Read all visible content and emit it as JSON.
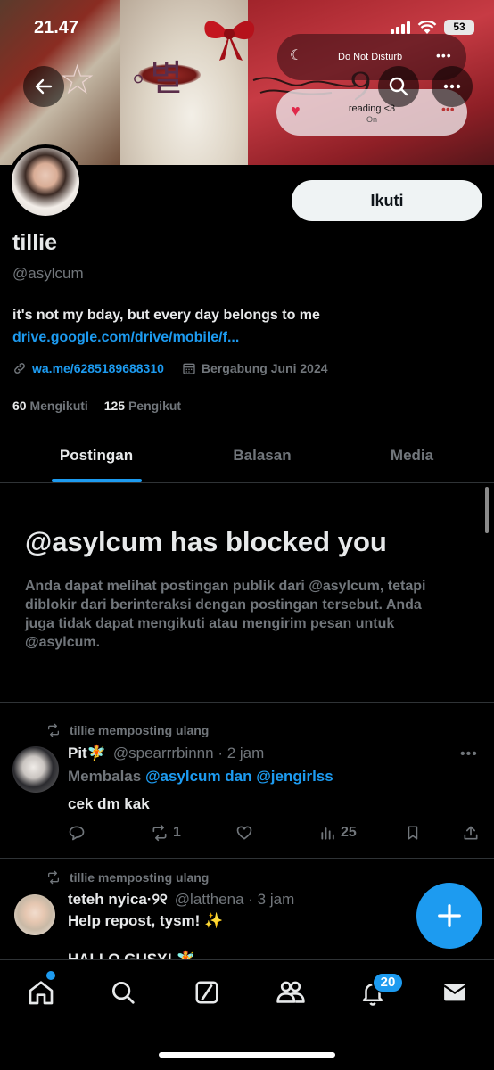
{
  "status_bar": {
    "time": "21.47",
    "battery": "53"
  },
  "banner": {
    "korean_text": "별",
    "dnd_label": "Do Not Disturb",
    "focus_title": "reading <3",
    "focus_subtitle": "On"
  },
  "profile": {
    "follow_label": "Ikuti",
    "name": "tillie",
    "handle": "@asylcum",
    "bio": "it's not my bday, but every day belongs to me",
    "bio_link": "drive.google.com/drive/mobile/f...",
    "website": "wa.me/6285189688310",
    "joined": "Bergabung Juni 2024",
    "following_count": "60",
    "following_label": "Mengikuti",
    "followers_count": "125",
    "followers_label": "Pengikut"
  },
  "tabs": [
    {
      "label": "Postingan",
      "active": true
    },
    {
      "label": "Balasan",
      "active": false
    },
    {
      "label": "Media",
      "active": false
    }
  ],
  "blocked": {
    "title": "@asylcum has blocked you",
    "text": "Anda dapat melihat postingan publik dari @asylcum, tetapi diblokir dari berinteraksi dengan postingan tersebut. Anda juga tidak dapat mengikuti atau mengirim pesan untuk @asylcum."
  },
  "posts": [
    {
      "repost_label": "tillie memposting ulang",
      "name": "Pit🧚",
      "handle": "@spearrrbinnn · 2 jam",
      "reply_prefix": "Membalas",
      "reply_mentions": "@asylcum dan @jengirlss",
      "body": "cek dm kak",
      "reposts": "1",
      "views": "25"
    },
    {
      "repost_label": "tillie memposting ulang",
      "name": "teteh nyica·୨୧",
      "handle": "@latthena · 3 jam",
      "body": "Help repost, tysm! ✨",
      "body2": "HALLO GUSY! 🧚"
    }
  ],
  "bottom_nav": {
    "notifications_badge": "20"
  },
  "colors": {
    "accent": "#1d9bf0",
    "background": "#000000",
    "muted": "#71767b",
    "text": "#e7e9ea"
  },
  "icons": [
    "back-arrow-icon",
    "search-icon",
    "more-icon",
    "link-icon",
    "calendar-icon",
    "repost-icon",
    "reply-icon",
    "like-icon",
    "views-icon",
    "bookmark-icon",
    "share-icon",
    "compose-icon",
    "home-icon",
    "grok-icon",
    "communities-icon",
    "bell-icon",
    "mail-icon"
  ]
}
